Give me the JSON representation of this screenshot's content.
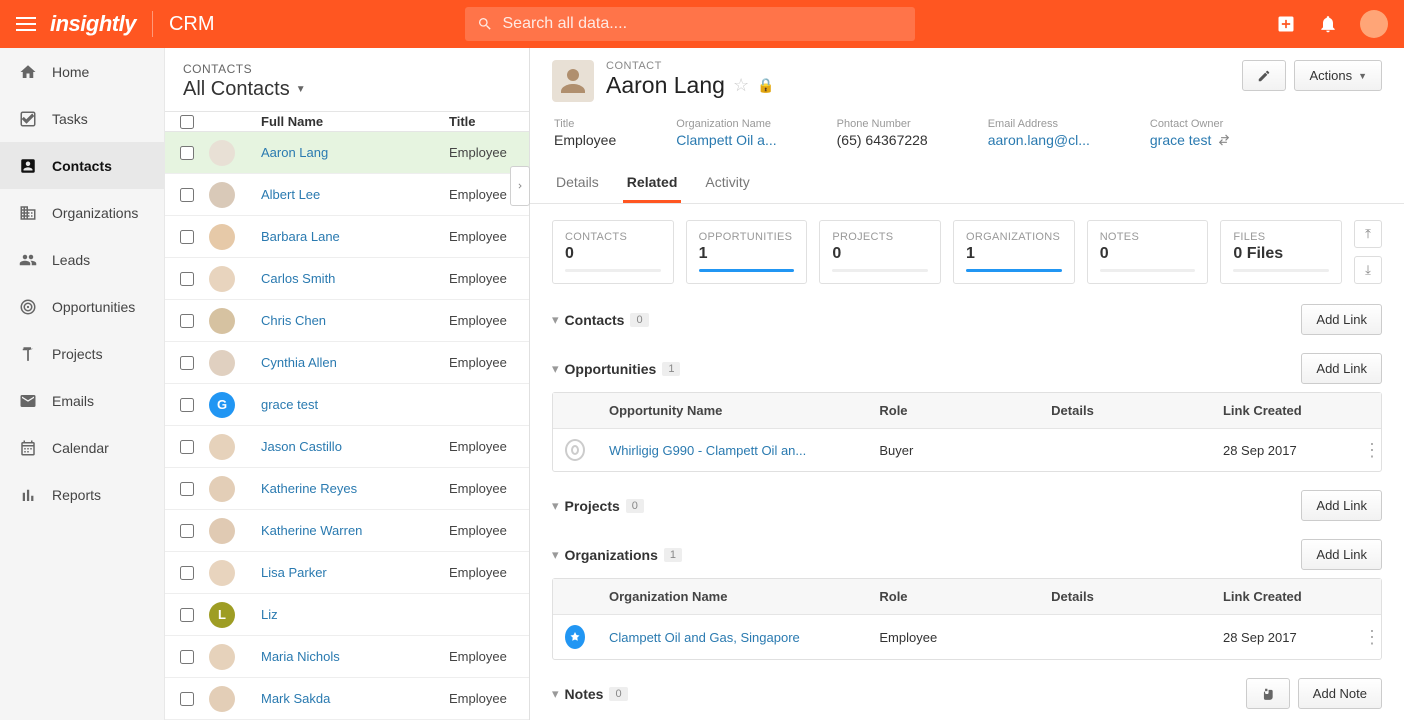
{
  "topbar": {
    "logo": "insightly",
    "app": "CRM",
    "search_placeholder": "Search all data...."
  },
  "nav": {
    "items": [
      {
        "label": "Home"
      },
      {
        "label": "Tasks"
      },
      {
        "label": "Contacts"
      },
      {
        "label": "Organizations"
      },
      {
        "label": "Leads"
      },
      {
        "label": "Opportunities"
      },
      {
        "label": "Projects"
      },
      {
        "label": "Emails"
      },
      {
        "label": "Calendar"
      },
      {
        "label": "Reports"
      }
    ]
  },
  "list": {
    "eyebrow": "CONTACTS",
    "title": "All Contacts",
    "col_name": "Full Name",
    "col_title": "Title",
    "rows": [
      {
        "name": "Aaron Lang",
        "title": "Employee",
        "avatar_bg": "#e8e0d5",
        "initial": ""
      },
      {
        "name": "Albert Lee",
        "title": "Employee",
        "avatar_bg": "#d9c9b8",
        "initial": ""
      },
      {
        "name": "Barbara Lane",
        "title": "Employee",
        "avatar_bg": "#e6c9a8",
        "initial": ""
      },
      {
        "name": "Carlos Smith",
        "title": "Employee",
        "avatar_bg": "#e8d4be",
        "initial": ""
      },
      {
        "name": "Chris Chen",
        "title": "Employee",
        "avatar_bg": "#d6c2a1",
        "initial": ""
      },
      {
        "name": "Cynthia Allen",
        "title": "Employee",
        "avatar_bg": "#e0d0c0",
        "initial": ""
      },
      {
        "name": "grace test",
        "title": "",
        "avatar_bg": "#2196f3",
        "initial": "G"
      },
      {
        "name": "Jason Castillo",
        "title": "Employee",
        "avatar_bg": "#e6d2bb",
        "initial": ""
      },
      {
        "name": "Katherine Reyes",
        "title": "Employee",
        "avatar_bg": "#e3ceb7",
        "initial": ""
      },
      {
        "name": "Katherine Warren",
        "title": "Employee",
        "avatar_bg": "#e0cab3",
        "initial": ""
      },
      {
        "name": "Lisa Parker",
        "title": "Employee",
        "avatar_bg": "#e8d4be",
        "initial": ""
      },
      {
        "name": "Liz",
        "title": "",
        "avatar_bg": "#9e9d24",
        "initial": "L"
      },
      {
        "name": "Maria Nichols",
        "title": "Employee",
        "avatar_bg": "#e6d2bb",
        "initial": ""
      },
      {
        "name": "Mark Sakda",
        "title": "Employee",
        "avatar_bg": "#e3ceb7",
        "initial": ""
      }
    ]
  },
  "detail": {
    "eyebrow": "CONTACT",
    "name": "Aaron Lang",
    "edit_label": "",
    "actions_label": "Actions",
    "fields": {
      "title_label": "Title",
      "title_val": "Employee",
      "org_label": "Organization Name",
      "org_val": "Clampett Oil a...",
      "phone_label": "Phone Number",
      "phone_val": "(65) 64367228",
      "email_label": "Email Address",
      "email_val": "aaron.lang@cl...",
      "owner_label": "Contact Owner",
      "owner_val": "grace test"
    },
    "tabs": {
      "details": "Details",
      "related": "Related",
      "activity": "Activity"
    },
    "stats": {
      "contacts_label": "CONTACTS",
      "contacts_val": "0",
      "opps_label": "OPPORTUNITIES",
      "opps_val": "1",
      "projects_label": "PROJECTS",
      "projects_val": "0",
      "orgs_label": "ORGANIZATIONS",
      "orgs_val": "1",
      "notes_label": "NOTES",
      "notes_val": "0",
      "files_label": "FILES",
      "files_val": "0 Files"
    },
    "sections": {
      "contacts_title": "Contacts",
      "contacts_count": "0",
      "opps_title": "Opportunities",
      "opps_count": "1",
      "projects_title": "Projects",
      "projects_count": "0",
      "orgs_title": "Organizations",
      "orgs_count": "1",
      "notes_title": "Notes",
      "notes_count": "0",
      "add_link": "Add Link",
      "add_note": "Add Note"
    },
    "opps_table": {
      "h_name": "Opportunity Name",
      "h_role": "Role",
      "h_details": "Details",
      "h_date": "Link Created",
      "row1_name": "Whirligig G990 - Clampett Oil an...",
      "row1_role": "Buyer",
      "row1_date": "28 Sep 2017"
    },
    "orgs_table": {
      "h_name": "Organization Name",
      "h_role": "Role",
      "h_details": "Details",
      "h_date": "Link Created",
      "row1_name": "Clampett Oil and Gas, Singapore",
      "row1_role": "Employee",
      "row1_date": "28 Sep 2017"
    }
  }
}
